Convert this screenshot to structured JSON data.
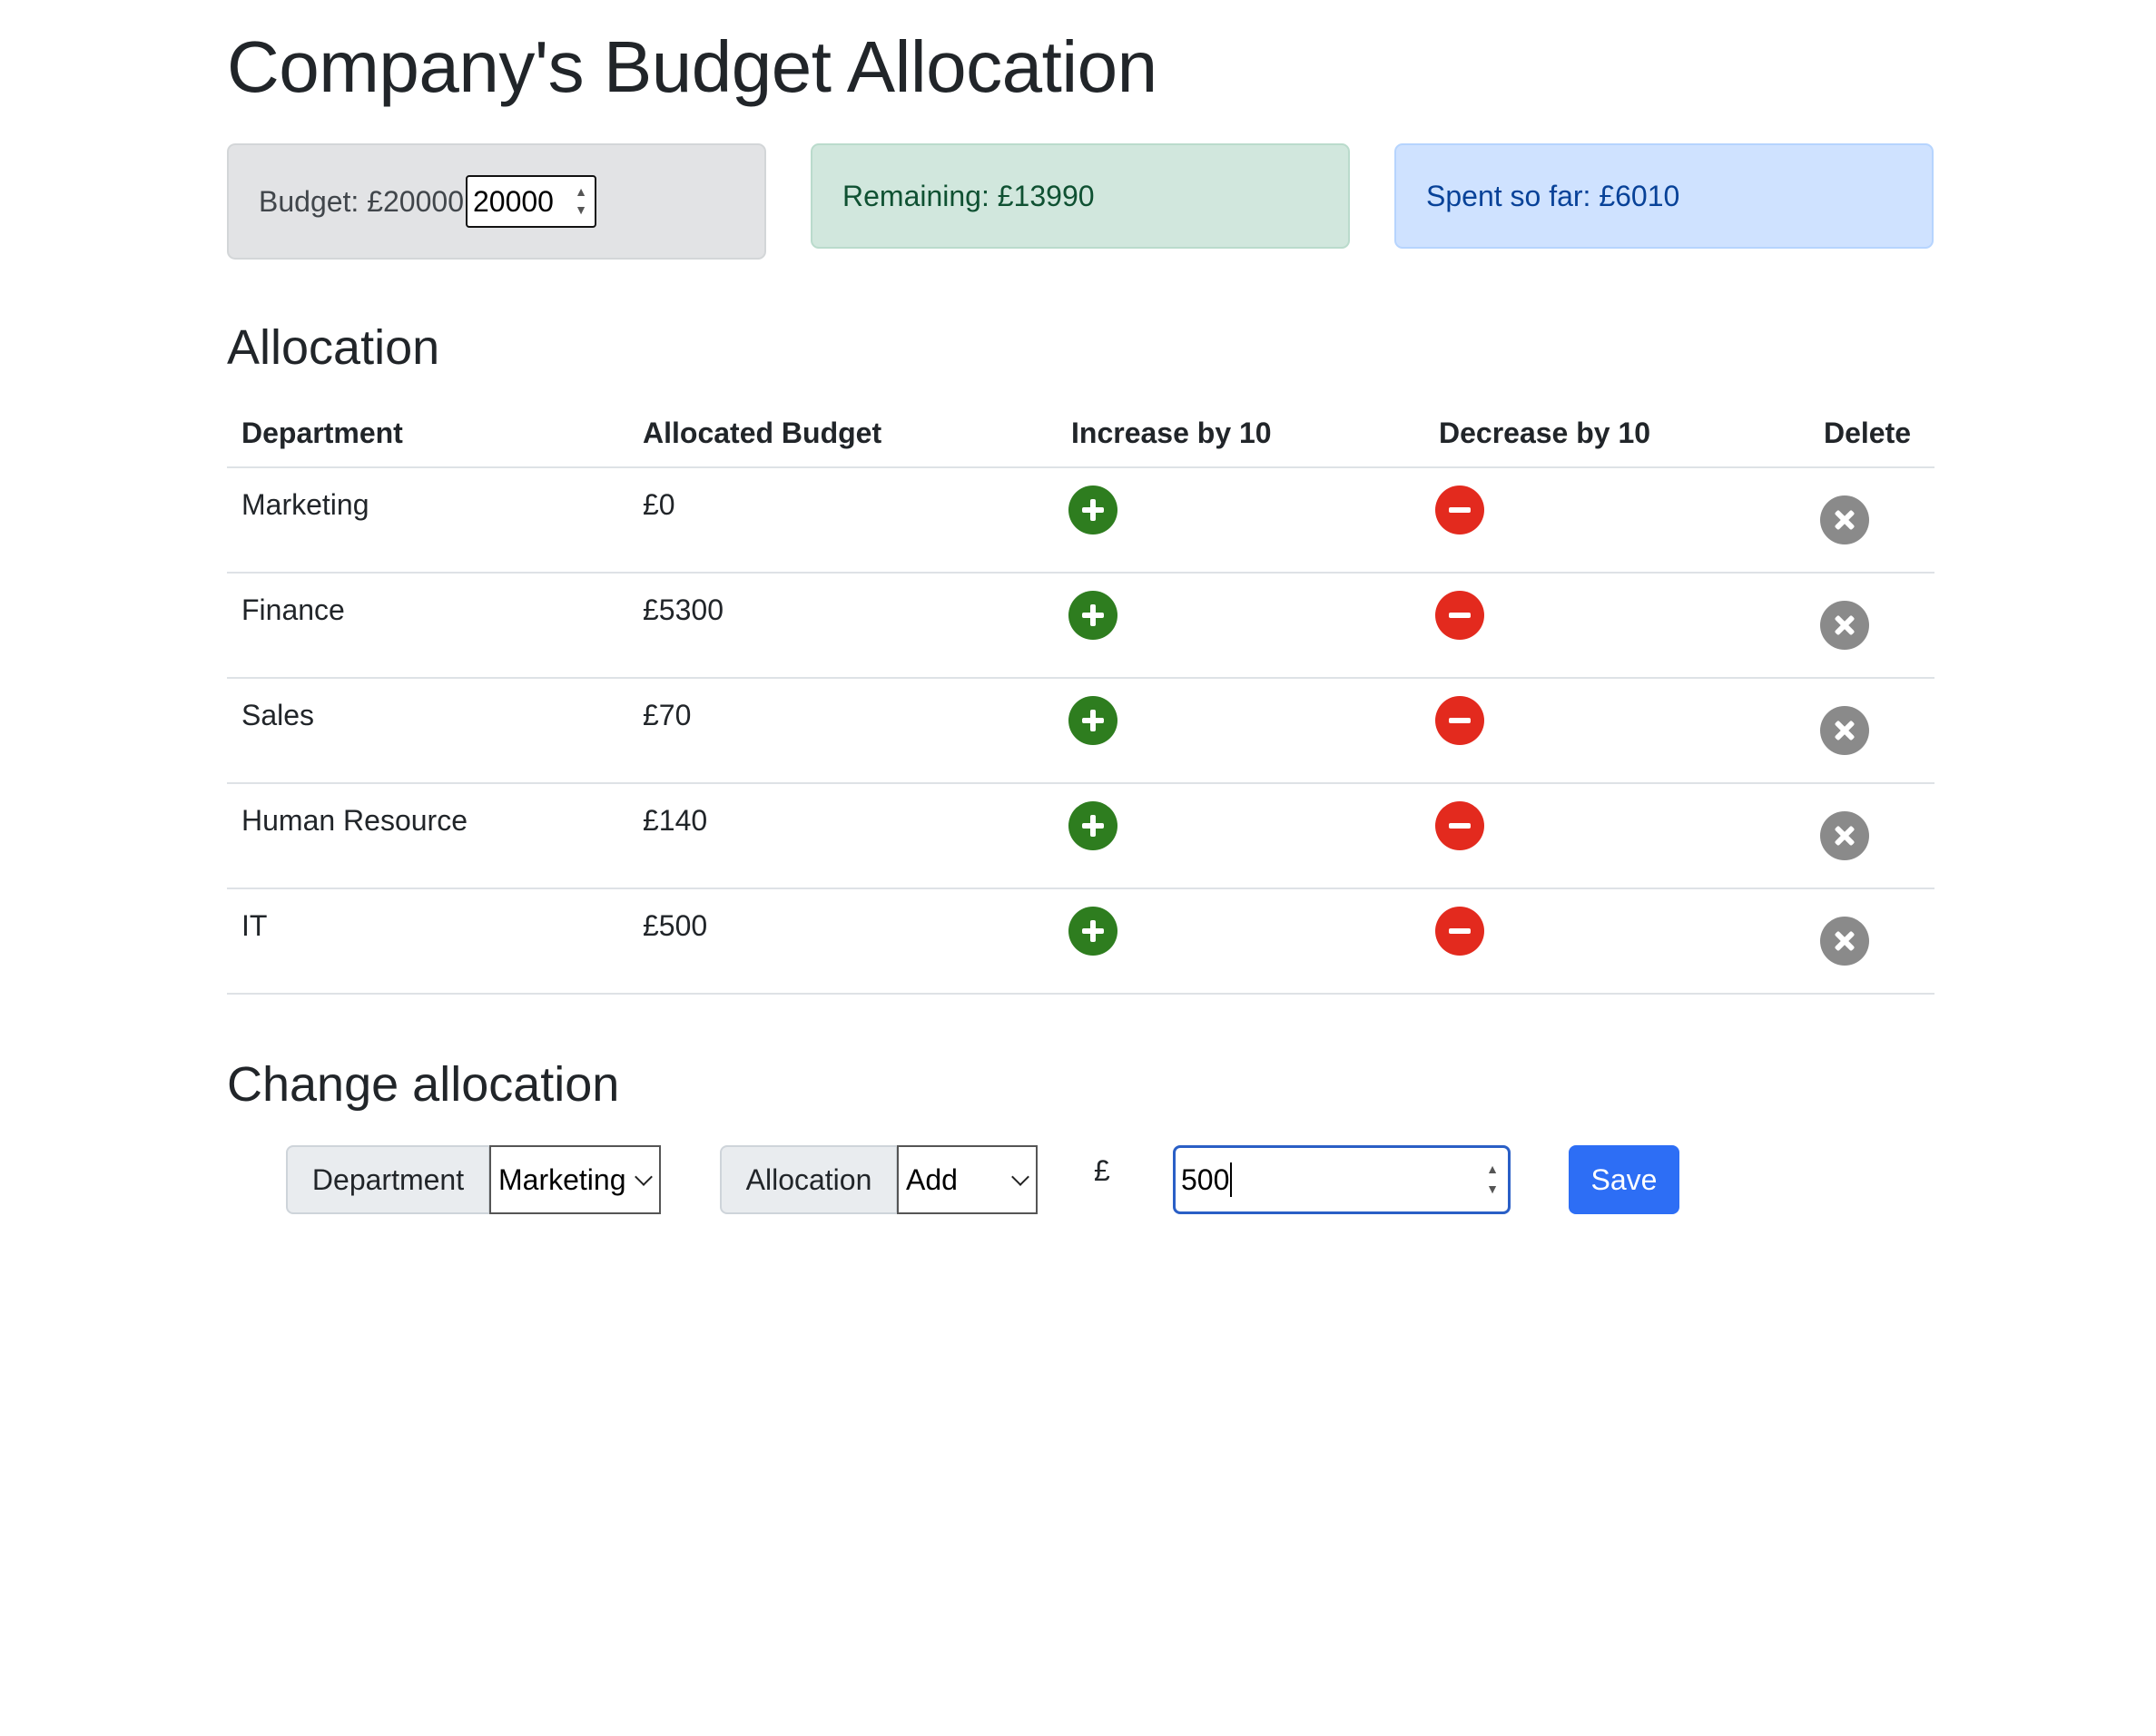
{
  "page": {
    "title": "Company's Budget Allocation"
  },
  "budget": {
    "label": "Budget: £20000",
    "input_value": "20000"
  },
  "remaining": {
    "text": "Remaining: £13990"
  },
  "spent": {
    "text": "Spent so far: £6010"
  },
  "allocation": {
    "title": "Allocation",
    "headers": [
      "Department",
      "Allocated Budget",
      "Increase by 10",
      "Decrease by 10",
      "Delete"
    ],
    "rows": [
      {
        "department": "Marketing",
        "budget": "£0"
      },
      {
        "department": "Finance",
        "budget": "£5300"
      },
      {
        "department": "Sales",
        "budget": "£70"
      },
      {
        "department": "Human Resource",
        "budget": "£140"
      },
      {
        "department": "IT",
        "budget": "£500"
      }
    ]
  },
  "change": {
    "title": "Change allocation",
    "department_label": "Department",
    "department_selected": "Marketing",
    "allocation_label": "Allocation",
    "allocation_selected": "Add",
    "currency_symbol": "£",
    "amount_value": "500",
    "save_label": "Save"
  },
  "colors": {
    "increase": "#2e7d1f",
    "decrease": "#e32a1e",
    "delete": "#8a8a8a",
    "save": "#2d6ef5"
  },
  "icons": {
    "increase": "plus-circle-icon",
    "decrease": "minus-circle-icon",
    "delete": "x-circle-icon"
  }
}
